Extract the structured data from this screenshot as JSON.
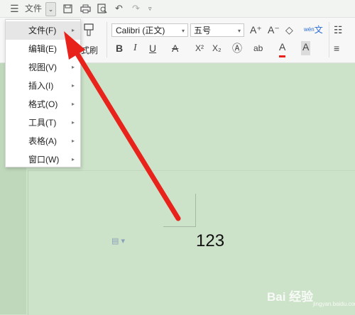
{
  "toolbar": {
    "menu_icon": "hamburger-icon",
    "file_label": "文件",
    "dropdown_icon": "chevron-down-icon",
    "save_icon": "save-icon",
    "print_icon": "print-icon",
    "preview_icon": "print-preview-icon",
    "undo_icon": "undo-icon",
    "redo_icon": "redo-icon",
    "more_icon": "customize-icon"
  },
  "ribbon": {
    "font_name": "Calibri (正文)",
    "font_size": "五号",
    "paste_label": "式刷",
    "grow_font": "A⁺",
    "shrink_font": "A⁻",
    "bold": "B",
    "italic": "I",
    "underline": "U",
    "strike": "A",
    "superscript": "X²",
    "subscript": "X₂",
    "font_color": "A",
    "char_border": "A",
    "phonetic": "wén",
    "highlight": "ab"
  },
  "menu": {
    "items": [
      {
        "label": "文件(F)"
      },
      {
        "label": "编辑(E)"
      },
      {
        "label": "视图(V)"
      },
      {
        "label": "插入(I)"
      },
      {
        "label": "格式(O)"
      },
      {
        "label": "工具(T)"
      },
      {
        "label": "表格(A)"
      },
      {
        "label": "窗口(W)"
      }
    ]
  },
  "document": {
    "text": "123"
  },
  "watermark": {
    "brand": "Bai 经验",
    "url": "jingyan.baidu.com"
  },
  "colors": {
    "arrow": "#e8231c",
    "doc_bg": "#cde3c9",
    "font_color_underline": "#e8231c"
  }
}
